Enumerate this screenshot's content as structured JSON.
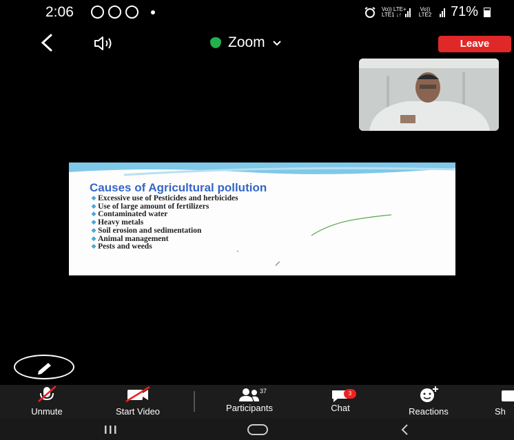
{
  "status_bar": {
    "time": "2:06",
    "signal1_label": "Vo)) LTE+\nLTE1 ↓↑",
    "signal2_label": "Vo))\nLTE2",
    "battery": "71%"
  },
  "header": {
    "app_title": "Zoom",
    "leave_label": "Leave"
  },
  "slide": {
    "title": "Causes of Agricultural pollution",
    "items": [
      "Excessive use of Pesticides and herbicides",
      "Use of large amount of fertilizers",
      "Contaminated water",
      "Heavy metals",
      "Soil erosion and sedimentation",
      "Animal management",
      "Pests and weeds"
    ]
  },
  "toolbar": {
    "unmute_label": "Unmute",
    "start_video_label": "Start Video",
    "participants_label": "Participants",
    "participants_count": "37",
    "chat_label": "Chat",
    "chat_badge": "3",
    "reactions_label": "Reactions",
    "share_label": "Sh"
  },
  "icons": {
    "back": "chevron-left-icon",
    "speaker": "speaker-icon",
    "security": "shield-icon",
    "annotate": "pencil-icon",
    "nav_recent": "recent-apps-icon",
    "nav_home": "home-icon",
    "nav_back": "back-icon"
  },
  "colors": {
    "leave": "#e02828",
    "shield": "#22b14c",
    "slide_title": "#3565c8",
    "badge": "#e22222"
  }
}
